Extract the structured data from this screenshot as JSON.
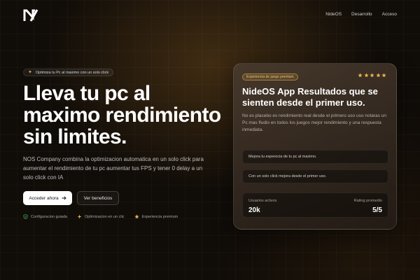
{
  "header": {
    "nav": [
      "NideOS",
      "Desarrollo",
      "Acceso"
    ]
  },
  "hero": {
    "badge": "Optimiza tu Pc al maximo con un solo click",
    "title": "Lleva tu pc al maximo rendimiento sin limites.",
    "description": "NOS Company combina la optimizacion automatica en un solo click para aumentar el rendimiento de tu pc aumentar tus FPS y tener 0 delay a un solo click con IA",
    "primary_button": "Acceder ahora",
    "secondary_button": "Ver beneficios",
    "features": [
      "Configuracion guiada",
      "Optimizacion en un clic",
      "Experiencia premium"
    ]
  },
  "card": {
    "badge": "Experiencia de juego premium",
    "rating_stars": 5,
    "title": "NideOS App Resultados que se sienten desde el primer uso.",
    "description": "No es placebo es rendimiento real desde el primero uso uso notaras un Pc mas fludio en todos los juegos mejor rendimiento y una respuesta inmediata.",
    "rows": [
      "Mejora tu experecia de tu pc al maximo.",
      "Con un solo click mejora desde el primer uso."
    ],
    "stats": {
      "users_label": "Usuarios activos",
      "users_value": "20k",
      "rating_label": "Rating promedio",
      "rating_value": "5/5"
    }
  },
  "colors": {
    "accent": "#e7b24d",
    "background": "#100c08",
    "feature_check": "#4caf50",
    "feature_spark": "#e7b24d"
  },
  "icons": [
    "logo-icon",
    "sparkle-icon",
    "arrow-right-icon",
    "shield-check-icon",
    "star-icon"
  ]
}
